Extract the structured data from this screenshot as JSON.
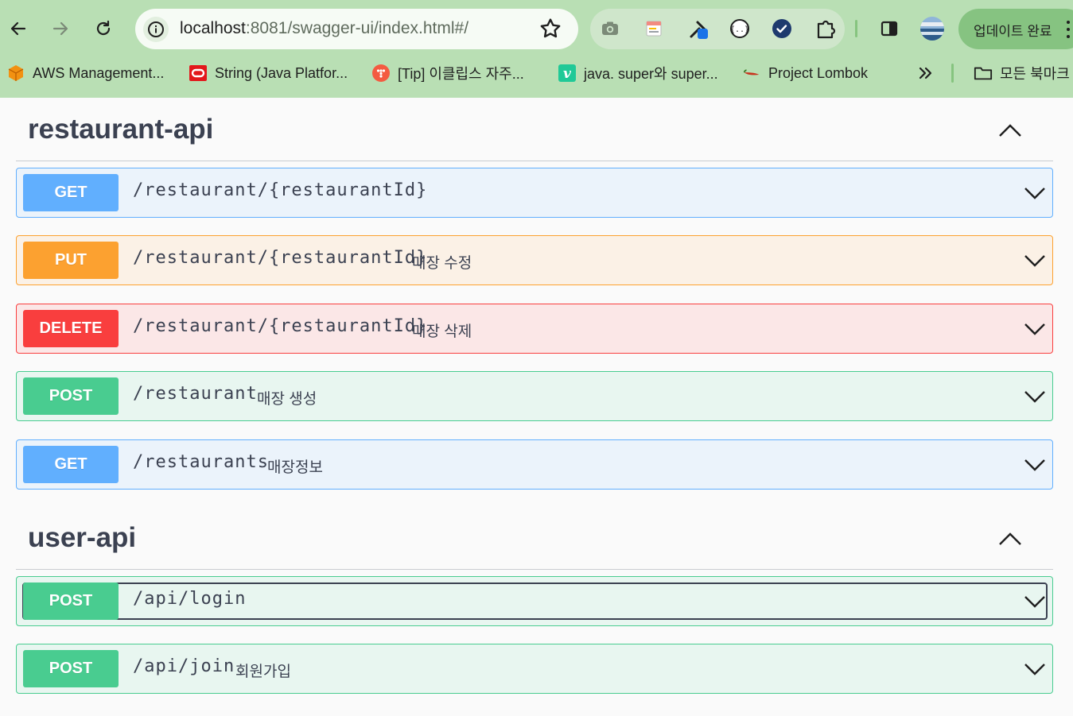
{
  "browser": {
    "url_host": "localhost",
    "url_rest": ":8081/swagger-ui/index.html#/",
    "update_label": "업데이트 완료",
    "bookmarks": [
      {
        "label": "AWS Management...",
        "icon": "aws-cube-icon"
      },
      {
        "label": "String (Java Platfor...",
        "icon": "oracle-icon"
      },
      {
        "label": "[Tip] 이클립스 자주...",
        "icon": "tistory-icon"
      },
      {
        "label": "java. super와 super...",
        "icon": "velog-icon"
      },
      {
        "label": "Project Lombok",
        "icon": "chili-pepper-icon"
      }
    ],
    "all_bookmarks_label": "모든 북마크",
    "colors": {
      "toolbar": "#b9dfb4",
      "update_button": "#86c381"
    }
  },
  "swagger": {
    "sections": [
      {
        "title": "restaurant-api",
        "operations": [
          {
            "method": "GET",
            "path": "/restaurant/{restaurantId}",
            "summary": ""
          },
          {
            "method": "PUT",
            "path": "/restaurant/{restaurantId}",
            "summary": "매장 수정"
          },
          {
            "method": "DELETE",
            "path": "/restaurant/{restaurantId}",
            "summary": "매장 삭제"
          },
          {
            "method": "POST",
            "path": "/restaurant",
            "summary": "매장 생성"
          },
          {
            "method": "GET",
            "path": "/restaurants",
            "summary": "매장정보"
          }
        ]
      },
      {
        "title": "user-api",
        "operations": [
          {
            "method": "POST",
            "path": "/api/login",
            "summary": ""
          },
          {
            "method": "POST",
            "path": "/api/join",
            "summary": "회원가입"
          }
        ]
      }
    ],
    "colors": {
      "get": "#61affe",
      "put": "#fca130",
      "delete": "#f93e3e",
      "post": "#49cc90",
      "text": "#3b4151"
    }
  }
}
